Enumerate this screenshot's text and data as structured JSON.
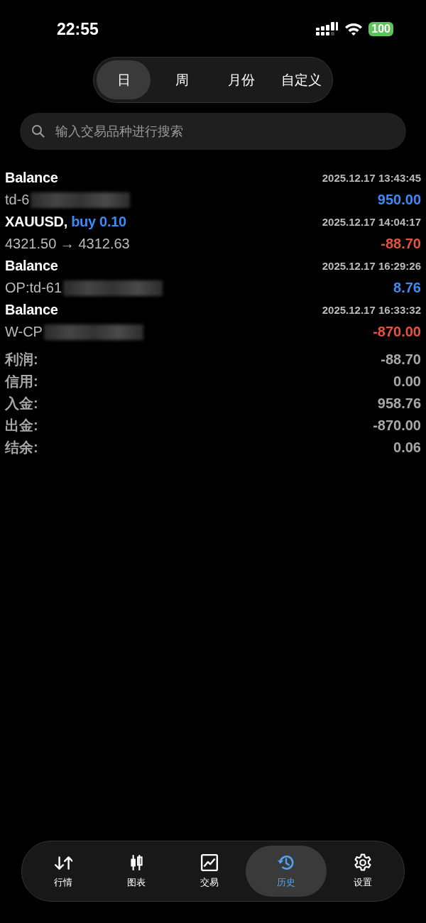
{
  "status_bar": {
    "time": "22:55",
    "battery": "100"
  },
  "period_tabs": [
    {
      "label": "日",
      "selected": true
    },
    {
      "label": "周",
      "selected": false
    },
    {
      "label": "月份",
      "selected": false
    },
    {
      "label": "自定义",
      "selected": false
    }
  ],
  "search": {
    "placeholder": "输入交易品种进行搜索"
  },
  "records": [
    {
      "title": "Balance",
      "time": "2025.12.17 13:43:45",
      "detail": "td-6",
      "redacted": true,
      "amount": "950.00",
      "color": "#3d8af7"
    },
    {
      "title": "XAUUSD,",
      "order": "buy 0.10",
      "time": "2025.12.17 14:04:17",
      "detail": "4321.50 → 4312.63",
      "redacted": false,
      "amount": "-88.70",
      "color": "#e5533f"
    },
    {
      "title": "Balance",
      "time": "2025.12.17 16:29:26",
      "detail": "OP:td-61",
      "redacted": true,
      "amount": "8.76",
      "color": "#3d8af7"
    },
    {
      "title": "Balance",
      "time": "2025.12.17 16:33:32",
      "detail": "W-CP",
      "redacted": true,
      "amount": "-870.00",
      "color": "#e5533f"
    }
  ],
  "summary": [
    {
      "label": "利润:",
      "value": "-88.70"
    },
    {
      "label": "信用:",
      "value": "0.00"
    },
    {
      "label": "入金:",
      "value": "958.76"
    },
    {
      "label": "出金:",
      "value": "-870.00"
    },
    {
      "label": "结余:",
      "value": "0.06"
    }
  ],
  "tab_bar": [
    {
      "kind": "quotes",
      "label": "行情",
      "selected": false
    },
    {
      "kind": "chart",
      "label": "图表",
      "selected": false
    },
    {
      "kind": "trade",
      "label": "交易",
      "selected": false
    },
    {
      "kind": "history",
      "label": "历史",
      "selected": true
    },
    {
      "kind": "settings",
      "label": "设置",
      "selected": false
    }
  ]
}
